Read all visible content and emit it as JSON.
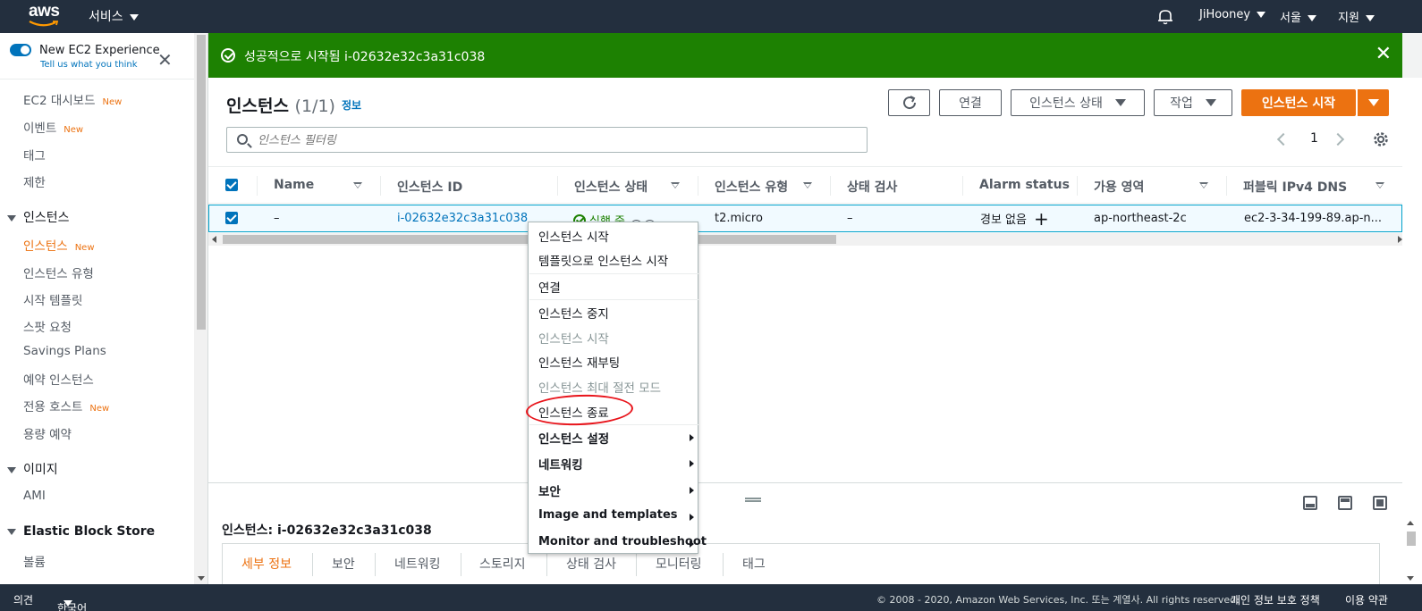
{
  "topnav": {
    "logo": "aws",
    "services": "서비스",
    "user": "JiHooney",
    "region": "서울",
    "support": "지원",
    "bell_icon": "bell-icon"
  },
  "sidebar": {
    "experience_title": "New EC2 Experience",
    "experience_sub": "Tell us what you think",
    "new_badge": "New",
    "items": [
      {
        "label": "EC2 대시보드"
      },
      {
        "label": "이벤트"
      },
      {
        "label": "태그"
      },
      {
        "label": "제한"
      }
    ],
    "group_instances": "인스턴스",
    "instances_items": [
      {
        "label": "인스턴스"
      },
      {
        "label": "인스턴스 유형"
      },
      {
        "label": "시작 템플릿"
      },
      {
        "label": "스팟 요청"
      },
      {
        "label": "Savings Plans"
      },
      {
        "label": "예약 인스턴스"
      },
      {
        "label": "전용 호스트"
      },
      {
        "label": "용량 예약"
      }
    ],
    "group_images": "이미지",
    "images_items": [
      {
        "label": "AMI"
      }
    ],
    "group_ebs": "Elastic Block Store",
    "ebs_items": [
      {
        "label": "볼륨"
      }
    ]
  },
  "flash": {
    "text": "성공적으로 시작됨 i-02632e32c3a31c038",
    "color": "#1d8102"
  },
  "main": {
    "title": "인스턴스",
    "count": "(1/1)",
    "info": "정보",
    "btn_connect": "연결",
    "btn_state": "인스턴스 상태",
    "btn_actions": "작업",
    "btn_launch": "인스턴스 시작",
    "filter_placeholder": "인스턴스 필터링",
    "page_number": "1",
    "accent": "#ec7211"
  },
  "table": {
    "columns": [
      "Name",
      "인스턴스 ID",
      "인스턴스 상태",
      "인스턴스 유형",
      "상태 검사",
      "Alarm status",
      "가용 영역",
      "퍼블릭 IPv4 DNS"
    ],
    "row": {
      "name": "–",
      "instance_id": "i-02632e32c3a31c038",
      "state": "실행 중",
      "type": "t2.micro",
      "status_check": "–",
      "alarm": "경보 없음",
      "az": "ap-northeast-2c",
      "dns": "ec2-3-34-199-89.ap-n..."
    }
  },
  "context_menu": {
    "items": [
      {
        "label": "인스턴스 시작",
        "disabled": false
      },
      {
        "label": "템플릿으로 인스턴스 시작",
        "disabled": false
      },
      {
        "label": "연결",
        "disabled": false
      },
      {
        "label": "인스턴스 중지",
        "disabled": false
      },
      {
        "label": "인스턴스 시작",
        "disabled": true
      },
      {
        "label": "인스턴스 재부팅",
        "disabled": false
      },
      {
        "label": "인스턴스 최대 절전 모드",
        "disabled": true
      },
      {
        "label": "인스턴스 종료",
        "disabled": false
      },
      {
        "label": "인스턴스 설정",
        "submenu": true
      },
      {
        "label": "네트워킹",
        "submenu": true
      },
      {
        "label": "보안",
        "submenu": true
      },
      {
        "label": "Image and templates",
        "submenu": true
      },
      {
        "label": "Monitor and troubleshoot",
        "submenu": true
      }
    ]
  },
  "details": {
    "title": "인스턴스: i-02632e32c3a31c038",
    "tabs": [
      "세부 정보",
      "보안",
      "네트워킹",
      "스토리지",
      "상태 검사",
      "모니터링",
      "태그"
    ]
  },
  "footer": {
    "feedback": "의견",
    "language": "한국어",
    "copyright": "© 2008 - 2020, Amazon Web Services, Inc. 또는 계열사. All rights reserved.",
    "privacy": "개인 정보 보호 정책",
    "terms": "이용 약관"
  }
}
